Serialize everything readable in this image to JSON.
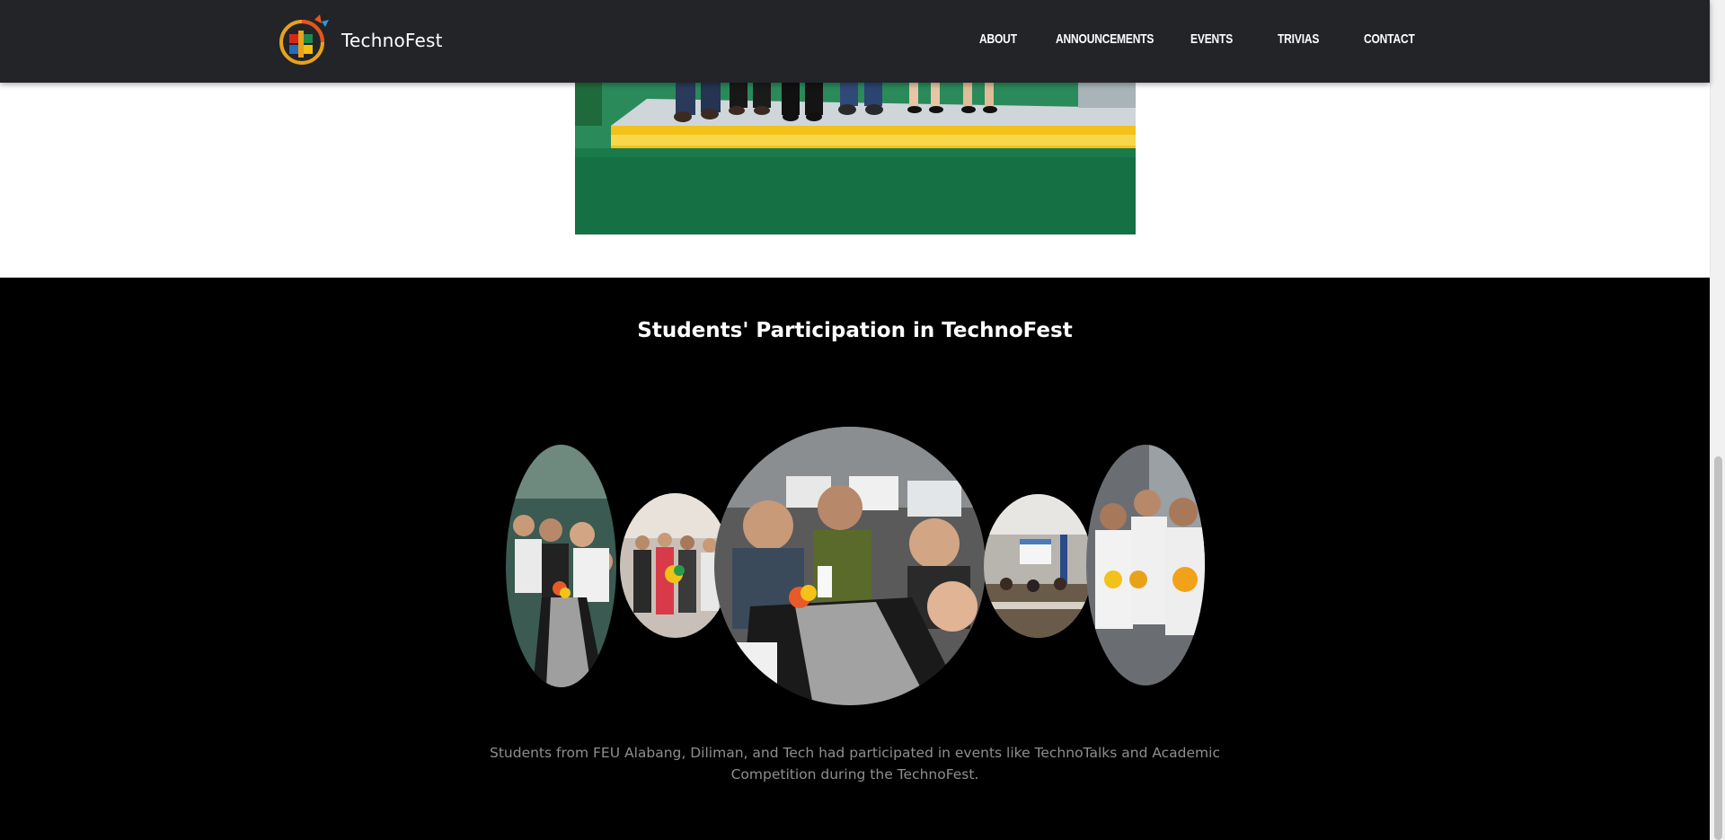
{
  "navbar": {
    "brand_name": "TechnoFest",
    "logo_icon": "technofest-logo-icon",
    "links": [
      {
        "label": "ABOUT"
      },
      {
        "label": "ANNOUNCEMENTS"
      },
      {
        "label": "EVENTS"
      },
      {
        "label": "TRIVIAS"
      },
      {
        "label": "CONTACT"
      }
    ],
    "background_color": "#222428"
  },
  "hero": {
    "photo_description_icon": "group-photo-image"
  },
  "participation": {
    "title": "Students' Participation in TechnoFest",
    "caption": "Students from FEU Alabang, Diliman, and Tech had participated in events like TechnoTalks and Academic Competition during the TechnoFest.",
    "gallery": [
      {
        "name": "students-dining-photo"
      },
      {
        "name": "group-with-flowers-photo"
      },
      {
        "name": "students-at-table-photo"
      },
      {
        "name": "seminar-room-photo"
      },
      {
        "name": "students-in-shirts-photo"
      }
    ],
    "background_color": "#000000",
    "caption_color": "#8e8e8e"
  }
}
